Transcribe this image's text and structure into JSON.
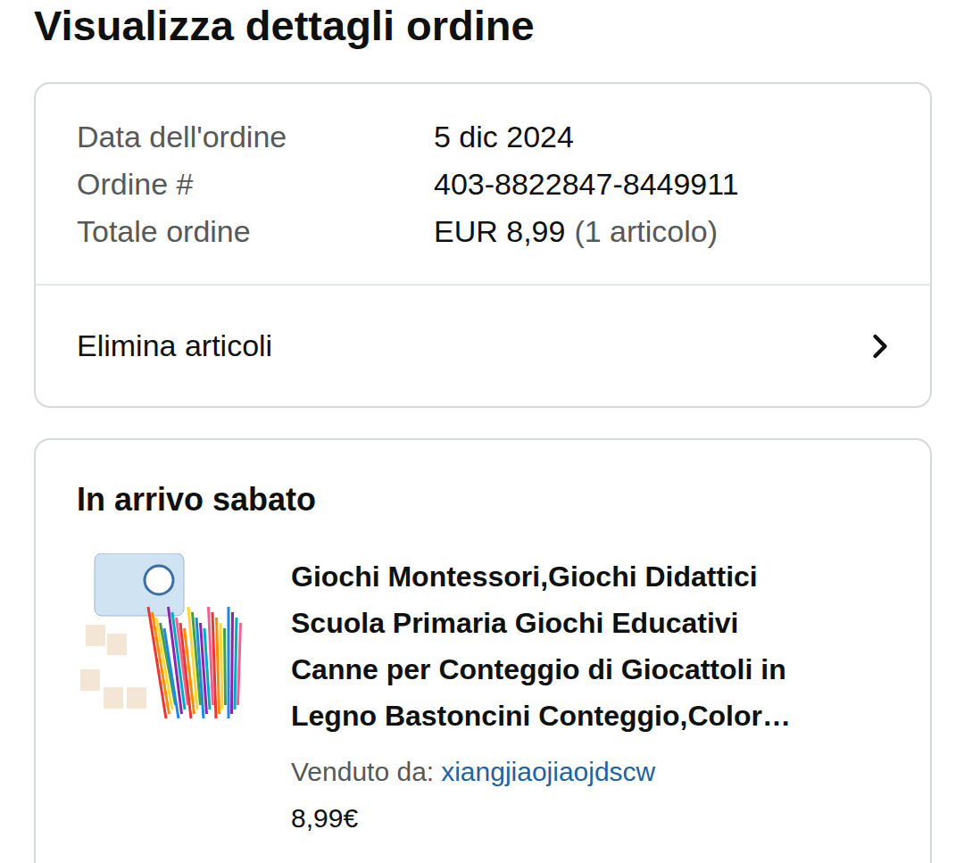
{
  "page": {
    "title": "Visualizza dettagli ordine"
  },
  "summary": {
    "rows": [
      {
        "label": "Data dell'ordine",
        "value": "5 dic 2024",
        "note": ""
      },
      {
        "label": "Ordine #",
        "value": "403-8822847-8449911",
        "note": ""
      },
      {
        "label": "Totale ordine",
        "value": "EUR 8,99",
        "note": "(1 articolo)"
      }
    ],
    "action": "Elimina articoli"
  },
  "shipment": {
    "status": "In arrivo sabato",
    "item": {
      "title_lines": [
        "Giochi Montessori,Giochi Didattici",
        "Scuola Primaria Giochi Educativi",
        "Canne per Conteggio di Giocattoli in",
        "Legno Bastoncini Conteggio,Color…"
      ],
      "seller_label": "Venduto da:",
      "seller": "xiangjiaojiaojdscw",
      "price": "8,99€"
    }
  }
}
